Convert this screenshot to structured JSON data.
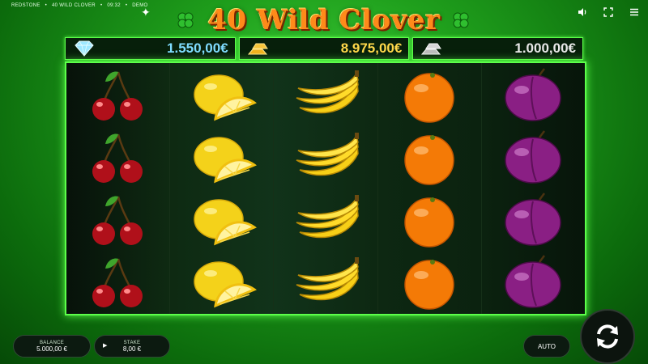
{
  "topbar": {
    "provider": "REDSTONE",
    "game": "40 WILD CLOVER",
    "time": "09:32",
    "mode": "DEMO"
  },
  "logo": {
    "text": "40 Wild Clover"
  },
  "hud_icons": [
    "sound-icon",
    "fullscreen-icon",
    "menu-icon"
  ],
  "jackpots": [
    {
      "icon": "diamond-icon",
      "value": "1.550,00€"
    },
    {
      "icon": "gold-bars-icon",
      "value": "8.975,00€"
    },
    {
      "icon": "silver-bars-icon",
      "value": "1.000,00€"
    }
  ],
  "reels": [
    [
      "cherry",
      "cherry",
      "cherry",
      "cherry"
    ],
    [
      "lemon",
      "lemon",
      "lemon",
      "lemon"
    ],
    [
      "banana",
      "banana",
      "banana",
      "banana"
    ],
    [
      "orange",
      "orange",
      "orange",
      "orange"
    ],
    [
      "plum",
      "plum",
      "plum",
      "plum"
    ]
  ],
  "controls": {
    "balance_label": "BALANCE",
    "balance_value": "5.000,00 €",
    "stake_label": "STAKE",
    "stake_value": "8,00 €",
    "auto_label": "AUTO"
  },
  "colors": {
    "accent_green": "#5cff4a",
    "logo_orange": "#ff8a1a",
    "diamond_value": "#7fdcff",
    "gold_value": "#ffd84a"
  }
}
